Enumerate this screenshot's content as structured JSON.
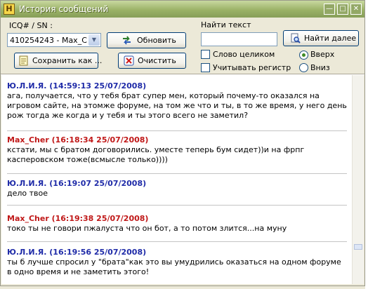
{
  "window": {
    "title": "История сообщений",
    "app_icon_letter": "H",
    "controls": [
      "minimize-icon",
      "maximize-icon",
      "close-icon"
    ]
  },
  "contact": {
    "label": "ICQ# / SN :",
    "selected": "410254243 - Max_Cher"
  },
  "buttons": {
    "refresh": "Обновить",
    "save_as": "Сохранить как ...",
    "clear": "Очистить",
    "find_next": "Найти далее"
  },
  "search": {
    "label": "Найти текст",
    "value": "",
    "whole_word": "Слово целиком",
    "match_case": "Учитывать регистр",
    "up": "Вверх",
    "down": "Вниз",
    "whole_word_checked": false,
    "match_case_checked": false,
    "direction": "up"
  },
  "messages": [
    {
      "header": "Ю.Л.И.Я. (14:59:13 25/07/2008)",
      "sender": "self",
      "text": "ага, получается, что у тебя брат супер мен, который почему-то оказался на игровом сайте, на этомже форуме, на том же что и ты, в то же время, у него день рож тогда же когда и у тебя и ты этого всего не заметил?"
    },
    {
      "header": "Max_Cher (16:18:34 25/07/2008)",
      "sender": "other",
      "text": "кстати, мы с братом договорились. уместе теперь бум сидет))и на фрпг касперовском тоже(всмысле только))))"
    },
    {
      "header": "Ю.Л.И.Я. (16:19:07 25/07/2008)",
      "sender": "self",
      "text": "дело твое"
    },
    {
      "header": "Max_Cher (16:19:38 25/07/2008)",
      "sender": "other",
      "text": "токо ты не говори пжалуста что он бот, а то потом злится...на муну"
    },
    {
      "header": "Ю.Л.И.Я. (16:19:56 25/07/2008)",
      "sender": "self",
      "text": "ты б лучше спросил у \"брата\"как это вы умудрились оказаться на одном форуме в одно время и не заметить этого!"
    }
  ],
  "colors": {
    "self_name": "#1f2ba8",
    "other_name": "#c01818",
    "titlebar": "#9bb267"
  }
}
